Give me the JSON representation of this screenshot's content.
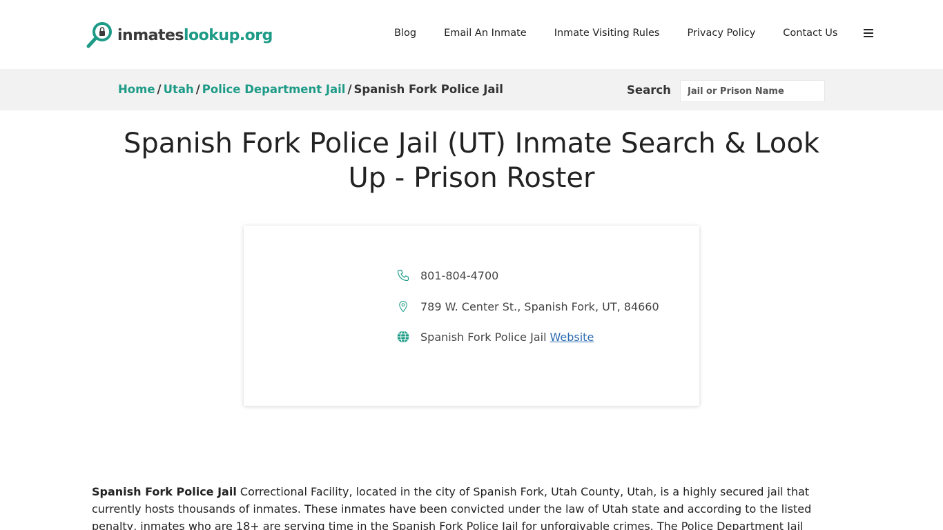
{
  "header": {
    "logo": {
      "part1": "inmates",
      "part2": "lookup.org"
    },
    "nav": [
      "Blog",
      "Email An Inmate",
      "Inmate Visiting Rules",
      "Privacy Policy",
      "Contact Us"
    ]
  },
  "breadcrumb": {
    "items": [
      "Home",
      "Utah",
      "Police Department Jail"
    ],
    "current": "Spanish Fork Police Jail",
    "separator": "/"
  },
  "search": {
    "label": "Search",
    "placeholder": "Jail or Prison Name"
  },
  "page_title": "Spanish Fork Police Jail (UT) Inmate Search & Look Up - Prison Roster",
  "card": {
    "phone": "801-804-4700",
    "address": "789 W. Center St., Spanish Fork, UT, 84660",
    "website_prefix": "Spanish Fork Police Jail",
    "website_link": "Website"
  },
  "article": {
    "lead": "Spanish Fork Police Jail",
    "text": " Correctional Facility, located in the city of Spanish Fork, Utah County, Utah, is a highly secured jail that currently hosts thousands of inmates. These inmates have been convicted under the law of Utah state and according to the listed penalty, inmates who are 18+ are serving time in the Spanish Fork Police Jail for unforgivable crimes. The Police Department Jail authority is responsible for looking after this"
  },
  "colors": {
    "accent": "#1d9b87",
    "link": "#2b6cb0",
    "bar": "#f2f2f2"
  },
  "icons": [
    "search-magnifier-lock-icon",
    "hamburger-menu-icon",
    "phone-icon",
    "map-pin-icon",
    "globe-icon"
  ]
}
